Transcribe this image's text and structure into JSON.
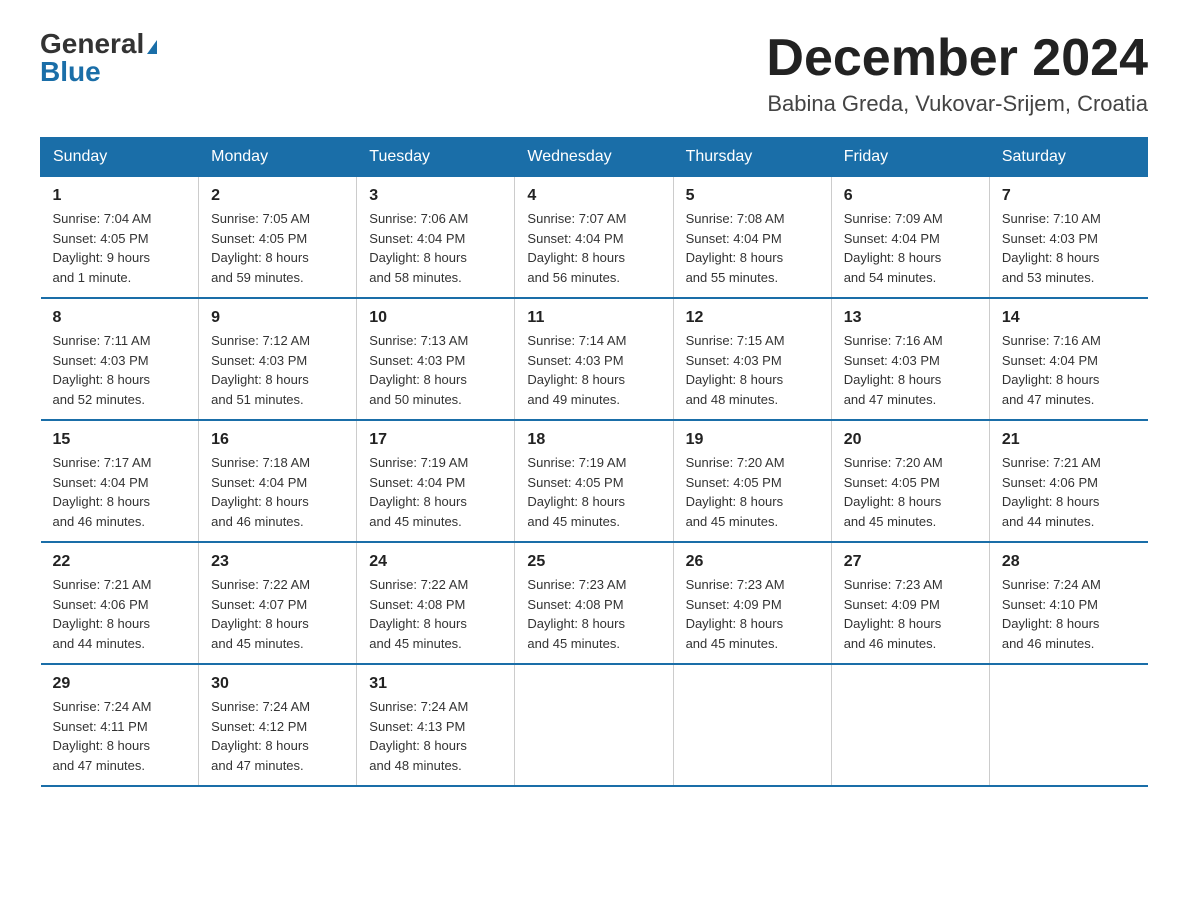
{
  "logo": {
    "general": "General",
    "blue": "Blue"
  },
  "title": "December 2024",
  "subtitle": "Babina Greda, Vukovar-Srijem, Croatia",
  "days_of_week": [
    "Sunday",
    "Monday",
    "Tuesday",
    "Wednesday",
    "Thursday",
    "Friday",
    "Saturday"
  ],
  "weeks": [
    [
      {
        "day": "1",
        "sunrise": "7:04 AM",
        "sunset": "4:05 PM",
        "daylight": "9 hours and 1 minute."
      },
      {
        "day": "2",
        "sunrise": "7:05 AM",
        "sunset": "4:05 PM",
        "daylight": "8 hours and 59 minutes."
      },
      {
        "day": "3",
        "sunrise": "7:06 AM",
        "sunset": "4:04 PM",
        "daylight": "8 hours and 58 minutes."
      },
      {
        "day": "4",
        "sunrise": "7:07 AM",
        "sunset": "4:04 PM",
        "daylight": "8 hours and 56 minutes."
      },
      {
        "day": "5",
        "sunrise": "7:08 AM",
        "sunset": "4:04 PM",
        "daylight": "8 hours and 55 minutes."
      },
      {
        "day": "6",
        "sunrise": "7:09 AM",
        "sunset": "4:04 PM",
        "daylight": "8 hours and 54 minutes."
      },
      {
        "day": "7",
        "sunrise": "7:10 AM",
        "sunset": "4:03 PM",
        "daylight": "8 hours and 53 minutes."
      }
    ],
    [
      {
        "day": "8",
        "sunrise": "7:11 AM",
        "sunset": "4:03 PM",
        "daylight": "8 hours and 52 minutes."
      },
      {
        "day": "9",
        "sunrise": "7:12 AM",
        "sunset": "4:03 PM",
        "daylight": "8 hours and 51 minutes."
      },
      {
        "day": "10",
        "sunrise": "7:13 AM",
        "sunset": "4:03 PM",
        "daylight": "8 hours and 50 minutes."
      },
      {
        "day": "11",
        "sunrise": "7:14 AM",
        "sunset": "4:03 PM",
        "daylight": "8 hours and 49 minutes."
      },
      {
        "day": "12",
        "sunrise": "7:15 AM",
        "sunset": "4:03 PM",
        "daylight": "8 hours and 48 minutes."
      },
      {
        "day": "13",
        "sunrise": "7:16 AM",
        "sunset": "4:03 PM",
        "daylight": "8 hours and 47 minutes."
      },
      {
        "day": "14",
        "sunrise": "7:16 AM",
        "sunset": "4:04 PM",
        "daylight": "8 hours and 47 minutes."
      }
    ],
    [
      {
        "day": "15",
        "sunrise": "7:17 AM",
        "sunset": "4:04 PM",
        "daylight": "8 hours and 46 minutes."
      },
      {
        "day": "16",
        "sunrise": "7:18 AM",
        "sunset": "4:04 PM",
        "daylight": "8 hours and 46 minutes."
      },
      {
        "day": "17",
        "sunrise": "7:19 AM",
        "sunset": "4:04 PM",
        "daylight": "8 hours and 45 minutes."
      },
      {
        "day": "18",
        "sunrise": "7:19 AM",
        "sunset": "4:05 PM",
        "daylight": "8 hours and 45 minutes."
      },
      {
        "day": "19",
        "sunrise": "7:20 AM",
        "sunset": "4:05 PM",
        "daylight": "8 hours and 45 minutes."
      },
      {
        "day": "20",
        "sunrise": "7:20 AM",
        "sunset": "4:05 PM",
        "daylight": "8 hours and 45 minutes."
      },
      {
        "day": "21",
        "sunrise": "7:21 AM",
        "sunset": "4:06 PM",
        "daylight": "8 hours and 44 minutes."
      }
    ],
    [
      {
        "day": "22",
        "sunrise": "7:21 AM",
        "sunset": "4:06 PM",
        "daylight": "8 hours and 44 minutes."
      },
      {
        "day": "23",
        "sunrise": "7:22 AM",
        "sunset": "4:07 PM",
        "daylight": "8 hours and 45 minutes."
      },
      {
        "day": "24",
        "sunrise": "7:22 AM",
        "sunset": "4:08 PM",
        "daylight": "8 hours and 45 minutes."
      },
      {
        "day": "25",
        "sunrise": "7:23 AM",
        "sunset": "4:08 PM",
        "daylight": "8 hours and 45 minutes."
      },
      {
        "day": "26",
        "sunrise": "7:23 AM",
        "sunset": "4:09 PM",
        "daylight": "8 hours and 45 minutes."
      },
      {
        "day": "27",
        "sunrise": "7:23 AM",
        "sunset": "4:09 PM",
        "daylight": "8 hours and 46 minutes."
      },
      {
        "day": "28",
        "sunrise": "7:24 AM",
        "sunset": "4:10 PM",
        "daylight": "8 hours and 46 minutes."
      }
    ],
    [
      {
        "day": "29",
        "sunrise": "7:24 AM",
        "sunset": "4:11 PM",
        "daylight": "8 hours and 47 minutes."
      },
      {
        "day": "30",
        "sunrise": "7:24 AM",
        "sunset": "4:12 PM",
        "daylight": "8 hours and 47 minutes."
      },
      {
        "day": "31",
        "sunrise": "7:24 AM",
        "sunset": "4:13 PM",
        "daylight": "8 hours and 48 minutes."
      },
      null,
      null,
      null,
      null
    ]
  ],
  "labels": {
    "sunrise": "Sunrise:",
    "sunset": "Sunset:",
    "daylight": "Daylight:"
  }
}
